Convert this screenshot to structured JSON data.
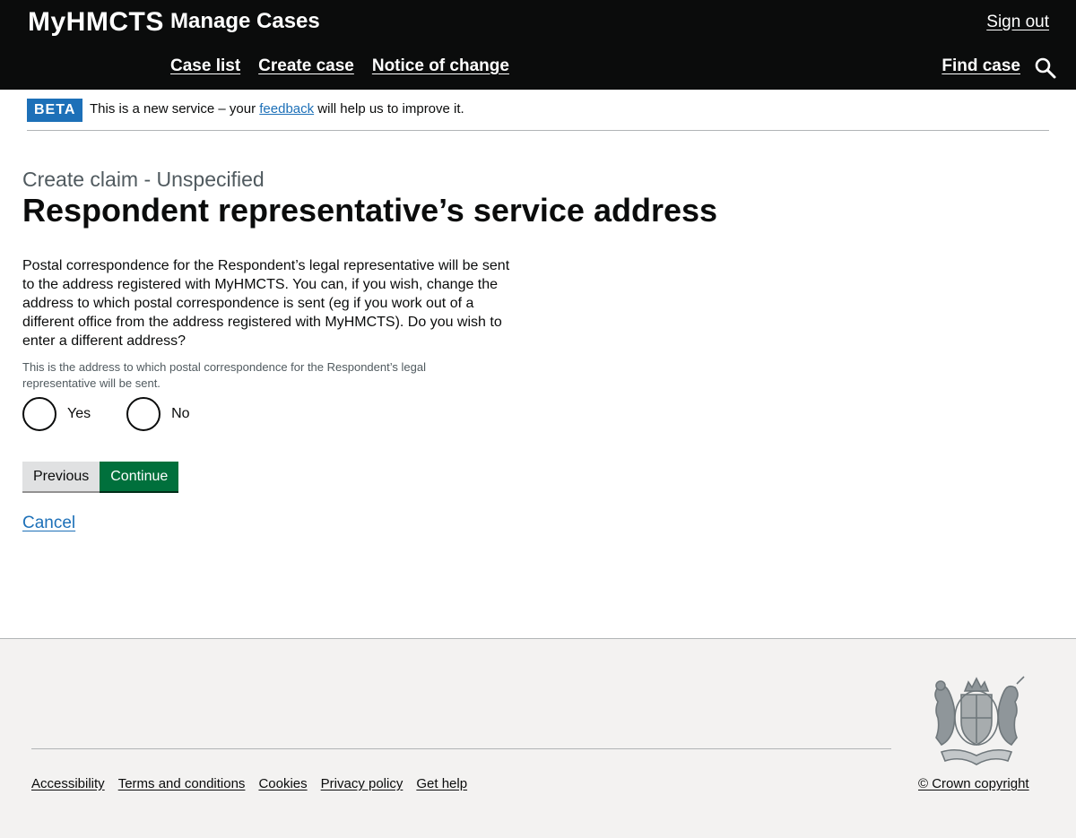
{
  "header": {
    "brand": "MyHMCTS",
    "service_name": "Manage Cases",
    "sign_out": "Sign out",
    "nav": [
      {
        "label": "Case list"
      },
      {
        "label": "Create case"
      },
      {
        "label": "Notice of change"
      }
    ],
    "find_case": "Find case",
    "search_icon": "search-icon"
  },
  "phase_banner": {
    "tag": "BETA",
    "text_before": "This is a new service – your ",
    "link": "feedback",
    "text_after": " will help us to improve it."
  },
  "main": {
    "caption": "Create claim - Unspecified",
    "title": "Respondent representative’s service address",
    "question": "Postal correspondence for the Respondent’s legal representative will be sent to the address registered with MyHMCTS. You can, if you wish, change the address to which postal correspondence is sent (eg if you work out of a different office from the address registered with MyHMCTS). Do you wish to enter a different address?",
    "hint": "This is the address to which postal correspondence for the Respondent’s legal representative will be sent.",
    "options": [
      {
        "label": "Yes"
      },
      {
        "label": "No"
      }
    ],
    "previous_label": "Previous",
    "continue_label": "Continue",
    "cancel_label": "Cancel"
  },
  "footer": {
    "links": [
      {
        "label": "Accessibility"
      },
      {
        "label": "Terms and conditions"
      },
      {
        "label": "Cookies"
      },
      {
        "label": "Privacy policy"
      },
      {
        "label": "Get help"
      }
    ],
    "crest_icon": "royal-coat-of-arms-icon",
    "copyright": "© Crown copyright"
  },
  "colors": {
    "header_bg": "#0b0c0c",
    "link": "#1d70b8",
    "beta_tag": "#1d70b8",
    "continue_button": "#00703c",
    "previous_button": "#e0e1e2",
    "footer_bg": "#f3f2f1"
  }
}
